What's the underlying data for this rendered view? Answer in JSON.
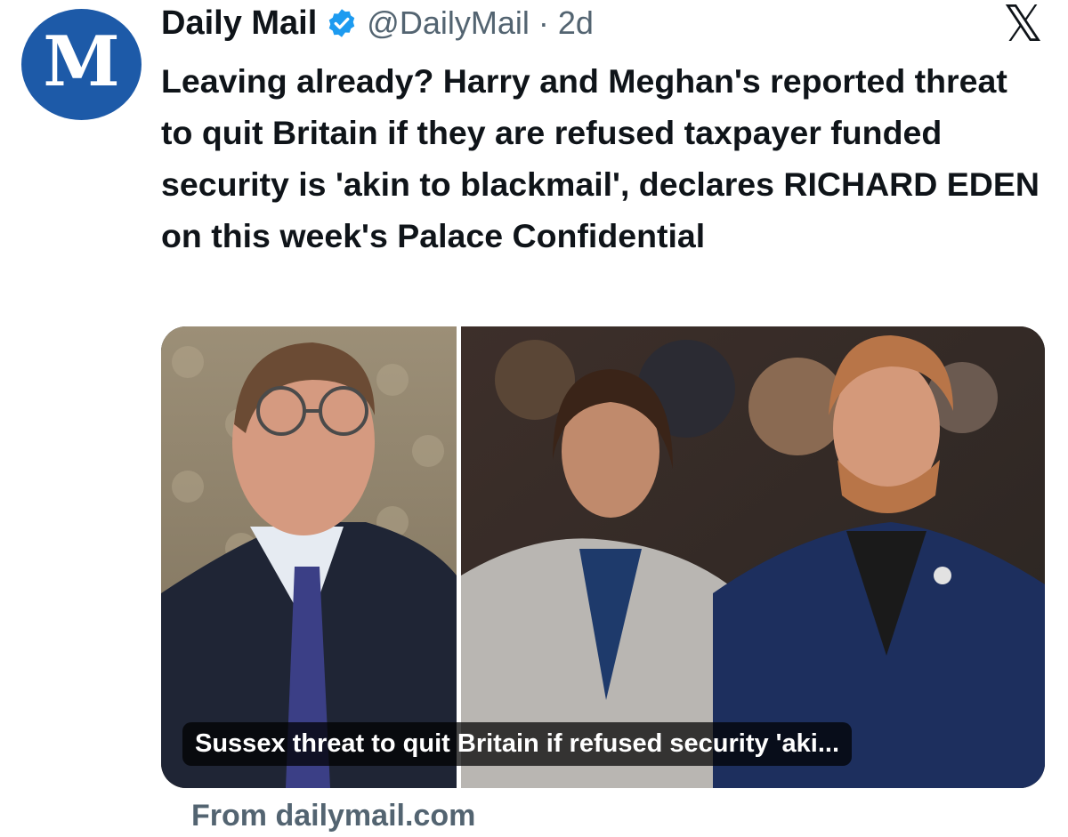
{
  "account": {
    "avatar_glyph": "M",
    "display_name": "Daily Mail",
    "handle": "@DailyMail",
    "separator": "·",
    "time": "2d",
    "verified_color": "#1d9bf0"
  },
  "close_icon": "x-logo-icon",
  "close_glyph": "𝕏",
  "tweet": {
    "text": "Leaving already? Harry and Meghan's reported threat to quit Britain if they are refused taxpayer funded security is 'akin to blackmail', declares RICHARD EDEN on this week's Palace Confidential"
  },
  "card": {
    "caption": "Sussex threat to quit Britain if refused security 'aki...",
    "source": "From dailymail.com"
  },
  "colors": {
    "avatar_bg": "#1d5aa8",
    "text": "#0f1419",
    "secondary": "#536471"
  }
}
